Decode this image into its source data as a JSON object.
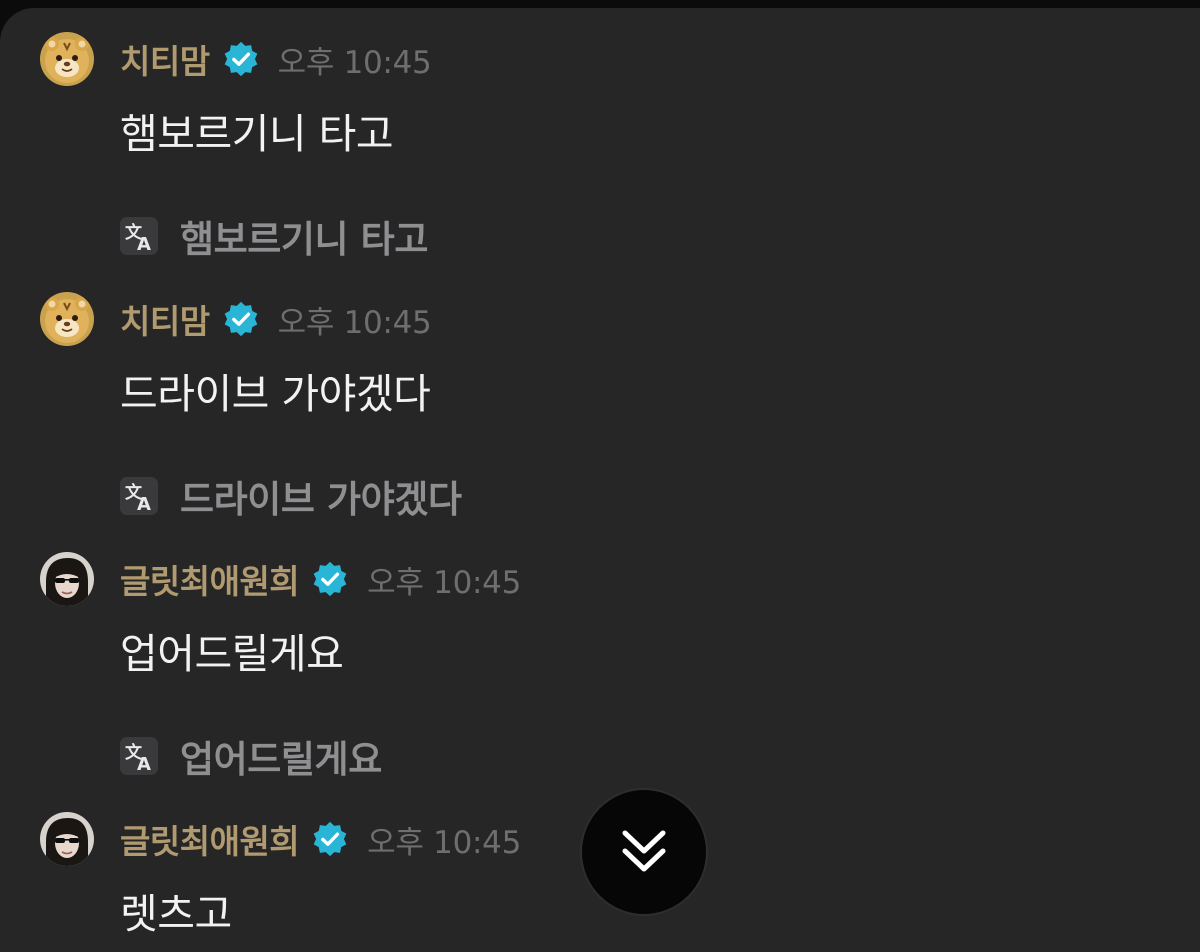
{
  "colors": {
    "background": "#262627",
    "username": "#b09a6f",
    "timestamp": "#6e6e70",
    "message_text": "#f2f2f2",
    "translation_text": "#8f8f91",
    "verified_badge": "#29b6d6"
  },
  "messages": [
    {
      "username": "치티맘",
      "avatar": "tiger-character-avatar",
      "verified": true,
      "timestamp": "오후 10:45",
      "text": "햄보르기니 타고",
      "translation_icon": "translate-icon",
      "translation": "햄보르기니 타고"
    },
    {
      "username": "치티맘",
      "avatar": "tiger-character-avatar",
      "verified": true,
      "timestamp": "오후 10:45",
      "text": "드라이브 가야겠다",
      "translation_icon": "translate-icon",
      "translation": "드라이브 가야겠다"
    },
    {
      "username": "글릿최애원희",
      "avatar": "person-sunglasses-avatar",
      "verified": true,
      "timestamp": "오후 10:45",
      "text": "업어드릴게요",
      "translation_icon": "translate-icon",
      "translation": "업어드릴게요"
    },
    {
      "username": "글릿최애원희",
      "avatar": "person-sunglasses-avatar",
      "verified": true,
      "timestamp": "오후 10:45",
      "text": "렛츠고"
    }
  ],
  "scroll_button": {
    "icon": "double-chevron-down-icon"
  }
}
